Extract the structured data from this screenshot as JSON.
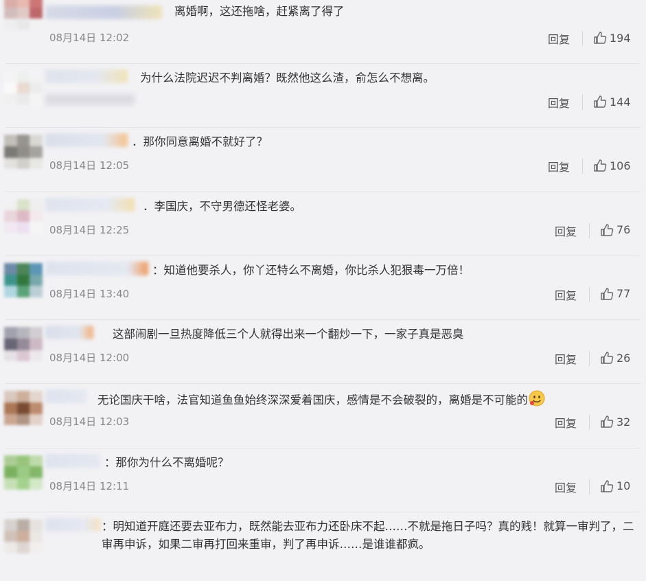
{
  "comments": [
    {
      "text": "离婚啊，这还拖啥，赶紧离了得了",
      "time": "08月14日 12:02",
      "reply": "回复",
      "likes": "194"
    },
    {
      "text": "为什么法院迟迟不判离婚？既然他这么渣，俞怎么不想离。",
      "time": "",
      "reply": "回复",
      "likes": "144"
    },
    {
      "text": "．那你同意离婚不就好了？",
      "time": "08月14日 12:05",
      "reply": "回复",
      "likes": "106"
    },
    {
      "text": "．李国庆，不守男德还怪老婆。",
      "time": "08月14日 12:25",
      "reply": "回复",
      "likes": "76"
    },
    {
      "text": "：知道他要杀人，你丫还特么不离婚，你比杀人犯狠毒一万倍！",
      "time": "08月14日 13:40",
      "reply": "回复",
      "likes": "77"
    },
    {
      "text": "这部闹剧一旦热度降低三个人就得出来一个翻炒一下，一家子真是恶臭",
      "time": "08月14日 12:00",
      "reply": "回复",
      "likes": "26"
    },
    {
      "text": "无论国庆干啥，法官知道鱼鱼始终深深爱着国庆，感情是不会破裂的，离婚是不可能的",
      "time": "08月14日 12:03",
      "reply": "回复",
      "likes": "32"
    },
    {
      "text": "：那你为什么不离婚呢？",
      "time": "08月14日 12:11",
      "reply": "回复",
      "likes": "10"
    },
    {
      "text": "：明知道开庭还要去亚布力，既然能去亚布力还卧床不起……不就是拖日子吗？真的贱！就算一审判了，二审再申诉，如果二审再打回来重审，判了再申诉……是谁谁都疯。",
      "time": "",
      "reply": "",
      "likes": ""
    }
  ]
}
